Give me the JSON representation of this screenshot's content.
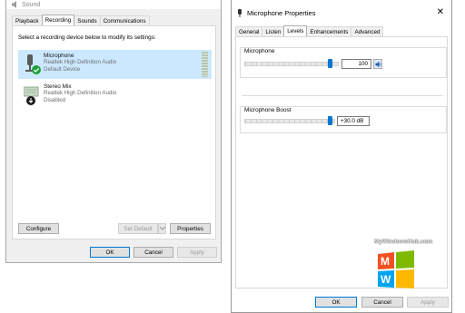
{
  "sound": {
    "title": "Sound",
    "tabs": [
      "Playback",
      "Recording",
      "Sounds",
      "Communications"
    ],
    "instruction": "Select a recording device below to modify its settings:",
    "devices": [
      {
        "name": "Microphone",
        "driver": "Realtek High Definition Audio",
        "status": "Default Device"
      },
      {
        "name": "Stereo Mix",
        "driver": "Realtek High Definition Audio",
        "status": "Disabled"
      }
    ],
    "buttons": {
      "configure": "Configure",
      "set_default": "Set Default",
      "properties": "Properties",
      "ok": "OK",
      "cancel": "Cancel",
      "apply": "Apply"
    }
  },
  "mic_props": {
    "title": "Microphone Properties",
    "close": "✕",
    "tabs": [
      "General",
      "Listen",
      "Levels",
      "Enhancements",
      "Advanced"
    ],
    "microphone": {
      "label": "Microphone",
      "value": "100"
    },
    "boost": {
      "label": "Microphone Boost",
      "value": "+30.0 dB"
    },
    "buttons": {
      "ok": "OK",
      "cancel": "Cancel",
      "apply": "Apply"
    }
  },
  "watermark": {
    "text": "MyWindowsHub.com",
    "letters": [
      "M",
      "W"
    ]
  },
  "colors": {
    "accent": "#0078d7",
    "selection": "#cce8ff",
    "disabled_text": "#9a9a9a"
  },
  "icons": [
    "speaker-icon",
    "microphone-icon",
    "check-icon",
    "stereo-mix-icon",
    "down-arrow-icon"
  ]
}
